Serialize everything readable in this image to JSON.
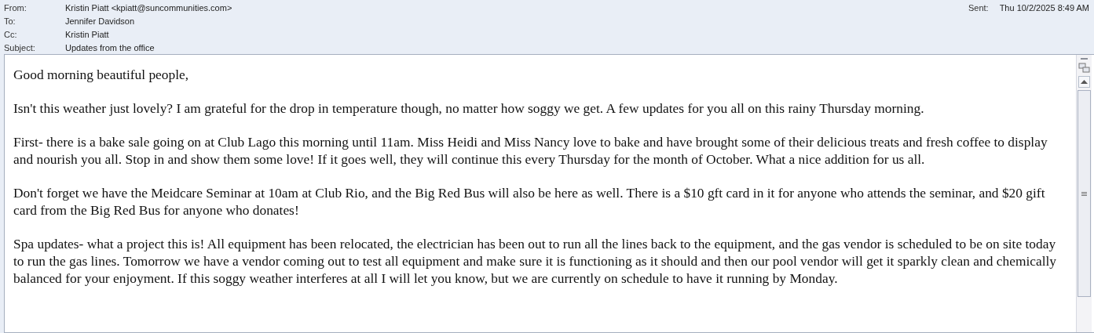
{
  "header": {
    "fields": [
      {
        "label": "From:",
        "value": "Kristin Piatt <kpiatt@suncommunities.com>"
      },
      {
        "label": "To:",
        "value": "Jennifer Davidson"
      },
      {
        "label": "Cc:",
        "value": "Kristin Piatt"
      },
      {
        "label": "Subject:",
        "value": "Updates from the office"
      }
    ],
    "sent": {
      "label": "Sent:",
      "value": "Thu 10/2/2025 8:49 AM"
    }
  },
  "body": {
    "paragraphs": [
      "Good morning beautiful people,",
      "Isn't this weather just lovely? I am grateful for the drop in temperature though, no matter how soggy we get. A few updates for you all on this rainy Thursday morning.",
      "First- there is a bake sale going on at Club Lago this morning until 11am. Miss Heidi and Miss Nancy love to bake and have brought some of their delicious treats and fresh coffee to display and nourish you all. Stop in and show them some love! If it goes well, they will continue this every Thursday for the month of October. What a nice addition for us all.",
      "Don't forget we have the Meidcare Seminar at 10am at Club Rio, and the Big Red Bus will also be here as well. There is a $10 gft card in it for anyone who attends the seminar, and $20 gift card from the Big Red Bus for anyone who donates!",
      "Spa updates- what a project this is! All equipment has been relocated, the electrician has been out to run all the lines back to the equipment, and the gas vendor is scheduled to be on site today to run the gas lines. Tomorrow we have a vendor coming out to test all equipment and make sure it is functioning as it should and then our pool vendor will get it sparkly clean and chemically balanced for your enjoyment. If this soggy weather interferes at all I will let you know, but we are currently on schedule to have it running by Monday."
    ]
  }
}
